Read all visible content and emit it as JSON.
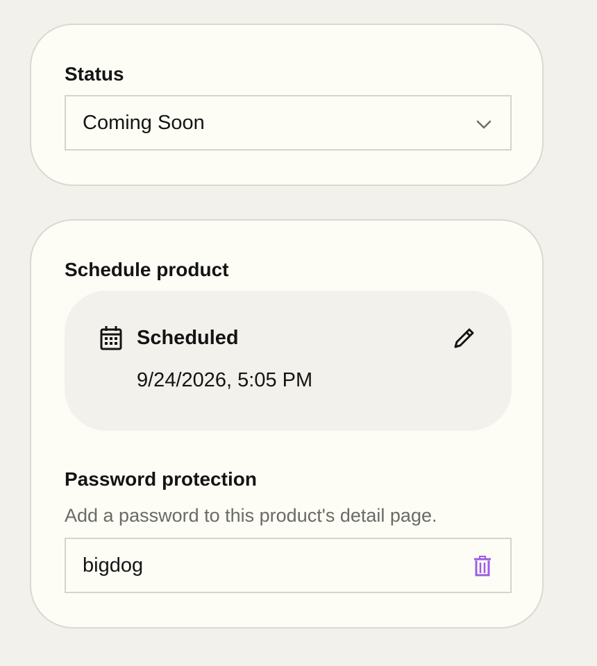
{
  "status_card": {
    "label": "Status",
    "select": {
      "value": "Coming Soon",
      "icon": "chevron-down-icon"
    }
  },
  "schedule_card": {
    "label": "Schedule product",
    "scheduled": {
      "icon": "calendar-icon",
      "title": "Scheduled",
      "datetime": "9/24/2026, 5:05 PM",
      "edit_icon": "pencil-icon"
    },
    "password": {
      "label": "Password protection",
      "description": "Add a password to this product's detail page.",
      "value": "bigdog",
      "delete_icon": "trash-icon",
      "delete_icon_color": "#9b5de5"
    }
  }
}
